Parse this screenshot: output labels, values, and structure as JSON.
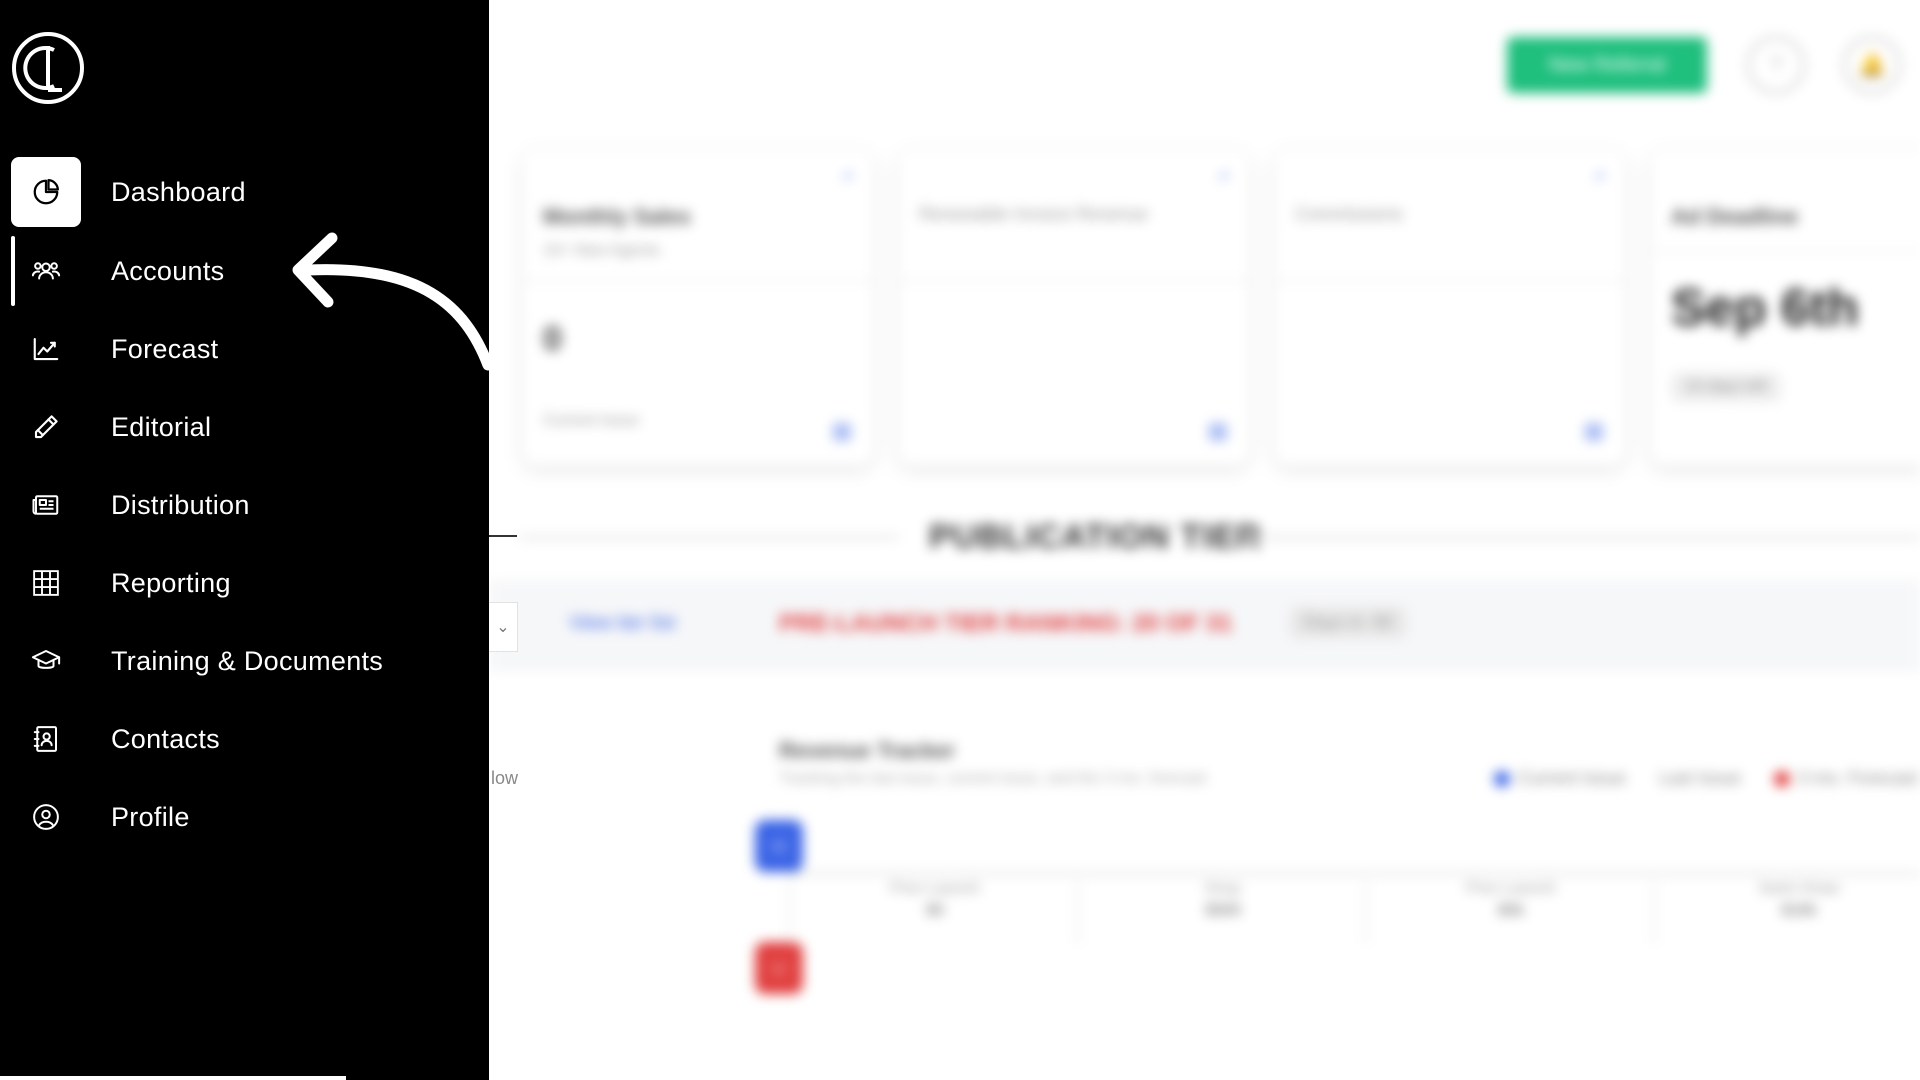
{
  "sidebar": {
    "logo_name": "brand-logo",
    "items": [
      {
        "label": "Dashboard",
        "icon": "pie-chart-icon",
        "active": true
      },
      {
        "label": "Accounts",
        "icon": "users-icon",
        "hover": true
      },
      {
        "label": "Forecast",
        "icon": "line-chart-icon"
      },
      {
        "label": "Editorial",
        "icon": "pencil-icon"
      },
      {
        "label": "Distribution",
        "icon": "newspaper-icon"
      },
      {
        "label": "Reporting",
        "icon": "grid-table-icon"
      },
      {
        "label": "Training & Documents",
        "icon": "graduation-cap-icon"
      },
      {
        "label": "Contacts",
        "icon": "contact-book-icon"
      },
      {
        "label": "Profile",
        "icon": "user-circle-icon"
      }
    ]
  },
  "background": {
    "new_button": "New Referral",
    "cards": [
      {
        "title": "Monthly Sales",
        "subtitle": "10+ New Agents",
        "link": "↗",
        "value": "0",
        "footer": "Current Issue"
      },
      {
        "title": "Renewable Invoice Revenue",
        "link": "↗"
      },
      {
        "title": "Commissions",
        "link": "↗"
      },
      {
        "title": "Ad Deadline",
        "date": "Sep 6th",
        "pill": "10 days left"
      }
    ],
    "tier_title": "PUBLICATION TIER",
    "band": {
      "link": "View tier list",
      "warning": "PRE-LAUNCH TIER RANKING: 20 OF 31",
      "chip": "Days in: 90"
    },
    "left_text": "low",
    "tracker": {
      "title": "Revenue Tracker",
      "subtitle": "Tracking the last issue, current issue, and the 3 mo. forecast",
      "legend": [
        {
          "label": "Current Issue",
          "color": "#3b64e6"
        },
        {
          "label": "Last Issue",
          "color": "#cccccc"
        },
        {
          "label": "3 mo. Forecast",
          "color": "#e14040"
        }
      ],
      "markers": [
        {
          "label": "CI",
          "color": "#3b64e6"
        },
        {
          "label": "LI",
          "color": "#e14040"
        }
      ],
      "columns": [
        {
          "label": "Prev Launch",
          "value": "$0"
        },
        {
          "label": "Drop",
          "value": "$500"
        },
        {
          "label": "Prev Launch",
          "value": "$5k"
        },
        {
          "label": "Swim Draw",
          "value": "$10k"
        }
      ]
    }
  },
  "colors": {
    "sidebar_bg": "#000000",
    "accent_green": "#1fbf7e",
    "link_blue": "#3b64e6",
    "warning_red": "#e14040"
  }
}
